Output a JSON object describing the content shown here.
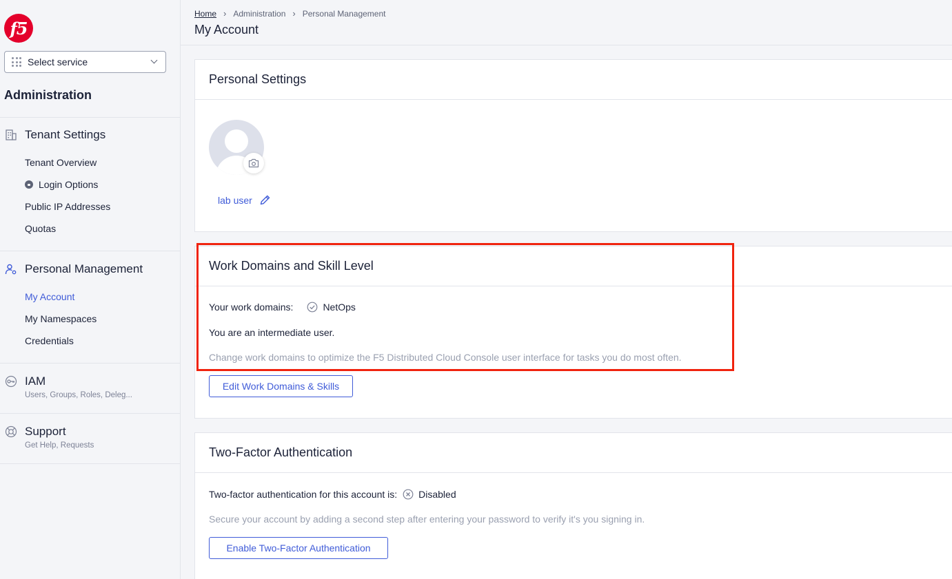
{
  "sidebar": {
    "logo_text": "f5",
    "select_service_label": "Select service",
    "section_title": "Administration",
    "tenant_settings": {
      "label": "Tenant Settings",
      "items": [
        "Tenant Overview",
        "Login Options",
        "Public IP Addresses",
        "Quotas"
      ]
    },
    "personal_management": {
      "label": "Personal Management",
      "items": [
        "My Account",
        "My Namespaces",
        "Credentials"
      ],
      "active": "My Account"
    },
    "iam": {
      "label": "IAM",
      "caption": "Users, Groups, Roles, Deleg..."
    },
    "support": {
      "label": "Support",
      "caption": "Get Help, Requests"
    }
  },
  "header": {
    "breadcrumb": [
      "Home",
      "Administration",
      "Personal Management"
    ],
    "title": "My Account"
  },
  "personal_settings": {
    "title": "Personal Settings",
    "user_name": "lab user"
  },
  "work_domains": {
    "title": "Work Domains and Skill Level",
    "domains_label": "Your work domains:",
    "domain_value": "NetOps",
    "skill_text": "You are an intermediate user.",
    "hint": "Change work domains to optimize the F5 Distributed Cloud Console user interface for tasks you do most often.",
    "edit_button": "Edit Work Domains & Skills"
  },
  "two_factor": {
    "title": "Two-Factor Authentication",
    "status_label": "Two-factor authentication for this account is:",
    "status_value": "Disabled",
    "hint": "Secure your account by adding a second step after entering your password to verify it's you signing in.",
    "enable_button": "Enable Two-Factor Authentication"
  },
  "colors": {
    "accent": "#3f5bd8",
    "brand": "#e4002b",
    "highlight": "#f0230e"
  }
}
